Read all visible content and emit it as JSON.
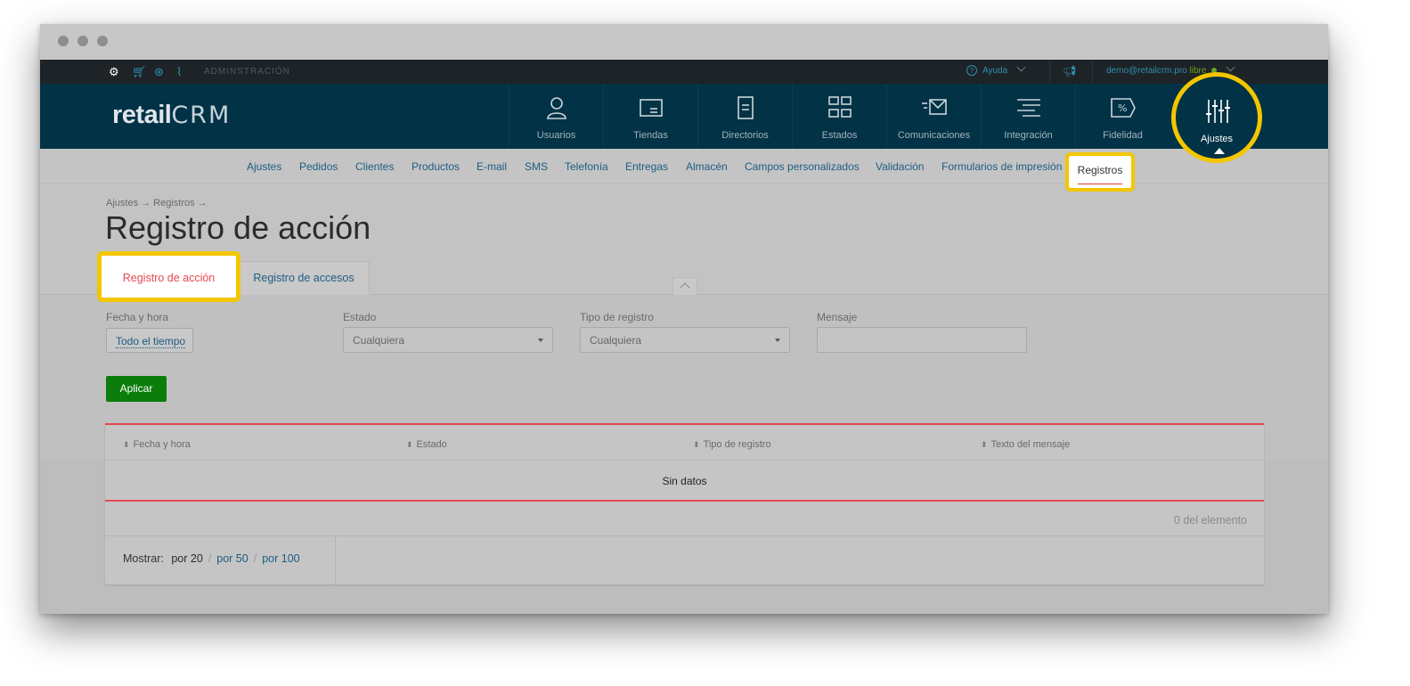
{
  "topbar": {
    "admin_label": "ADMINSTRACIÓN",
    "help_label": "Ayuda",
    "user_email": "demo@retailcrm.pro",
    "user_plan": "libre",
    "icons": [
      "gear-icon",
      "cart-icon",
      "support-icon",
      "analytics-icon"
    ]
  },
  "header": {
    "logo_text": "retail",
    "logo_crm": "CRM",
    "nav": [
      {
        "label": "Usuarios",
        "icon": "user-icon"
      },
      {
        "label": "Tiendas",
        "icon": "store-icon"
      },
      {
        "label": "Directorios",
        "icon": "directory-icon"
      },
      {
        "label": "Estados",
        "icon": "status-icon"
      },
      {
        "label": "Comunicaciones",
        "icon": "communication-icon"
      },
      {
        "label": "Integración",
        "icon": "integration-icon"
      },
      {
        "label": "Fidelidad",
        "icon": "loyalty-icon"
      },
      {
        "label": "Ajustes",
        "icon": "settings-sliders-icon",
        "active": true
      }
    ]
  },
  "subnav": {
    "items": [
      "Ajustes",
      "Pedidos",
      "Clientes",
      "Productos",
      "E-mail",
      "SMS",
      "Telefonía",
      "Entregas",
      "Almacén",
      "Campos personalizados",
      "Validación",
      "Formularios de impresión",
      "Registros"
    ],
    "active": "Registros"
  },
  "page": {
    "breadcrumb": "Ajustes → Registros →",
    "title": "Registro de acción",
    "tabs": [
      {
        "label": "Registro de acción",
        "active": true
      },
      {
        "label": "Registro de accesos",
        "active": false
      }
    ]
  },
  "filters": {
    "date_label": "Fecha y hora",
    "date_value": "Todo el tiempo",
    "status_label": "Estado",
    "status_value": "Cualquiera",
    "type_label": "Tipo de registro",
    "type_value": "Cualquiera",
    "message_label": "Mensaje",
    "message_value": "",
    "apply_label": "Aplicar"
  },
  "table": {
    "columns": [
      "Fecha y hora",
      "Estado",
      "Tipo de registro",
      "Texto del mensaje"
    ],
    "empty_text": "Sin datos",
    "count_text": "0 del elemento",
    "pager_label": "Mostrar:",
    "pager_current": "por 20",
    "pager_options": [
      "por 50",
      "por 100"
    ]
  },
  "colors": {
    "header_bg": "#023246",
    "highlight": "#f3c600",
    "accent_red": "#e34850",
    "apply_green": "#0b7d0b",
    "link_blue": "#1d5d83"
  }
}
